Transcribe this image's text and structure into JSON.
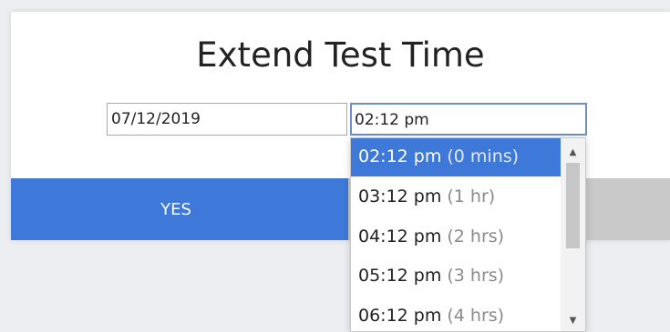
{
  "dialog": {
    "title": "Extend Test Time",
    "date_value": "07/12/2019",
    "time_value": "02:12 pm",
    "yes_label": "YES"
  },
  "dropdown": {
    "options": [
      {
        "time": "02:12 pm",
        "note": "(0 mins)",
        "selected": true
      },
      {
        "time": "03:12 pm",
        "note": "(1 hr)"
      },
      {
        "time": "04:12 pm",
        "note": "(2 hrs)"
      },
      {
        "time": "05:12 pm",
        "note": "(3 hrs)"
      },
      {
        "time": "06:12 pm",
        "note": "(4 hrs)"
      }
    ],
    "scroll_up_icon": "triangle-up",
    "scroll_down_icon": "triangle-down"
  },
  "colors": {
    "accent": "#3e78d8",
    "focus_border": "#6e8ec7",
    "secondary_button": "#c9c9c9"
  }
}
